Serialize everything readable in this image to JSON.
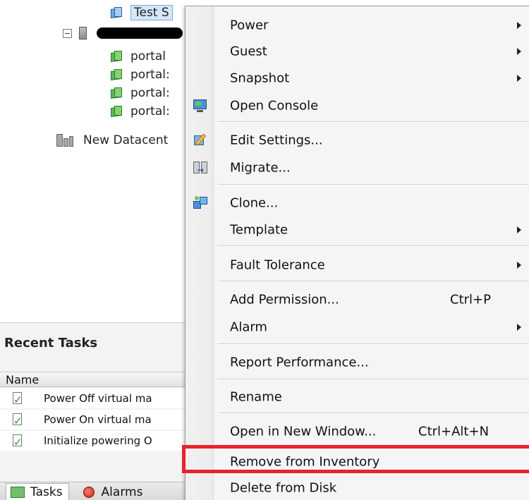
{
  "tree": {
    "selected_vm_label": "Test S",
    "host_label_redacted": true,
    "vms": [
      "portal",
      "portal:",
      "portal:",
      "portal:"
    ],
    "datacenter_label": "New Datacent"
  },
  "recent_tasks": {
    "title": "Recent Tasks",
    "column_name": "Name",
    "rows": [
      "Power Off virtual ma",
      "Power On virtual ma",
      "Initialize powering O"
    ],
    "tabs": {
      "tasks": "Tasks",
      "alarms": "Alarms"
    }
  },
  "context_menu": {
    "items": {
      "power": "Power",
      "guest": "Guest",
      "snapshot": "Snapshot",
      "open_console": "Open Console",
      "edit_settings": "Edit Settings...",
      "migrate": "Migrate...",
      "clone": "Clone...",
      "template": "Template",
      "fault_tolerance": "Fault Tolerance",
      "add_permission": "Add Permission...",
      "add_permission_shortcut": "Ctrl+P",
      "alarm": "Alarm",
      "report_performance": "Report Performance...",
      "rename": "Rename",
      "open_in_new_window": "Open in New Window...",
      "open_in_new_window_shortcut": "Ctrl+Alt+N",
      "remove_from_inventory": "Remove from Inventory",
      "delete_from_disk": "Delete from Disk"
    },
    "highlight_color": "#e8232e"
  }
}
